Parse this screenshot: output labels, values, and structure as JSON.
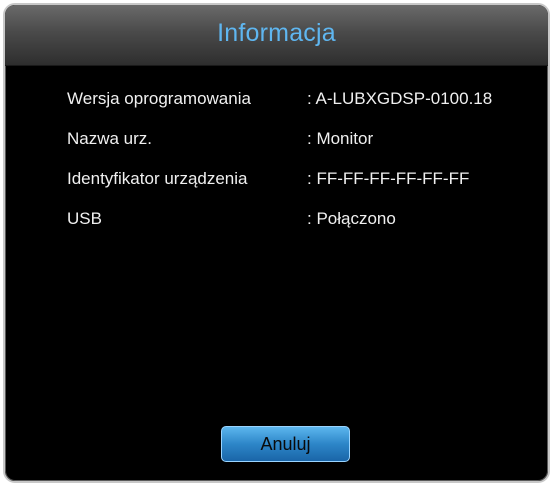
{
  "dialog": {
    "title": "Informacja",
    "rows": [
      {
        "label": "Wersja oprogramowania",
        "value": ": A-LUBXGDSP-0100.18"
      },
      {
        "label": "Nazwa urz.",
        "value": ": Monitor"
      },
      {
        "label": "Identyfikator urządzenia",
        "value": ": FF-FF-FF-FF-FF-FF"
      },
      {
        "label": "USB",
        "value": ": Połączono"
      }
    ],
    "cancel_label": "Anuluj"
  },
  "colors": {
    "title": "#5fb6f0",
    "background": "#000000",
    "button": "#2d86c8",
    "text": "#f0f0f0"
  }
}
